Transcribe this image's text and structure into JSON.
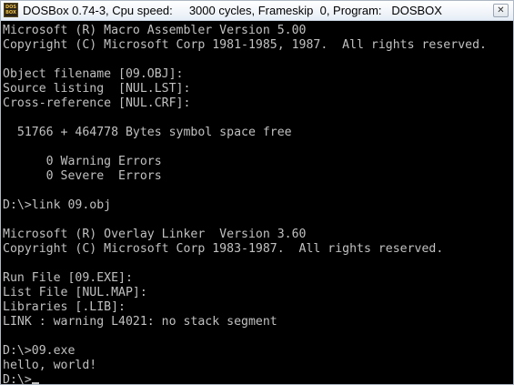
{
  "window": {
    "title": "DOSBox 0.74-3, Cpu speed:     3000 cycles, Frameskip  0, Program:   DOSBOX",
    "icon_label_top": "DOS",
    "icon_label_bottom": "BOX",
    "close_label": "✕"
  },
  "console": {
    "text_color": "#c0c0c0",
    "background": "#000000",
    "lines": [
      "Microsoft (R) Macro Assembler Version 5.00",
      "Copyright (C) Microsoft Corp 1981-1985, 1987.  All rights reserved.",
      "",
      "Object filename [09.OBJ]:",
      "Source listing  [NUL.LST]:",
      "Cross-reference [NUL.CRF]:",
      "",
      "  51766 + 464778 Bytes symbol space free",
      "",
      "      0 Warning Errors",
      "      0 Severe  Errors",
      "",
      "D:\\>link 09.obj",
      "",
      "Microsoft (R) Overlay Linker  Version 3.60",
      "Copyright (C) Microsoft Corp 1983-1987.  All rights reserved.",
      "",
      "Run File [09.EXE]:",
      "List File [NUL.MAP]:",
      "Libraries [.LIB]:",
      "LINK : warning L4021: no stack segment",
      "",
      "D:\\>09.exe",
      "hello, world!"
    ],
    "prompt": "D:\\>"
  }
}
